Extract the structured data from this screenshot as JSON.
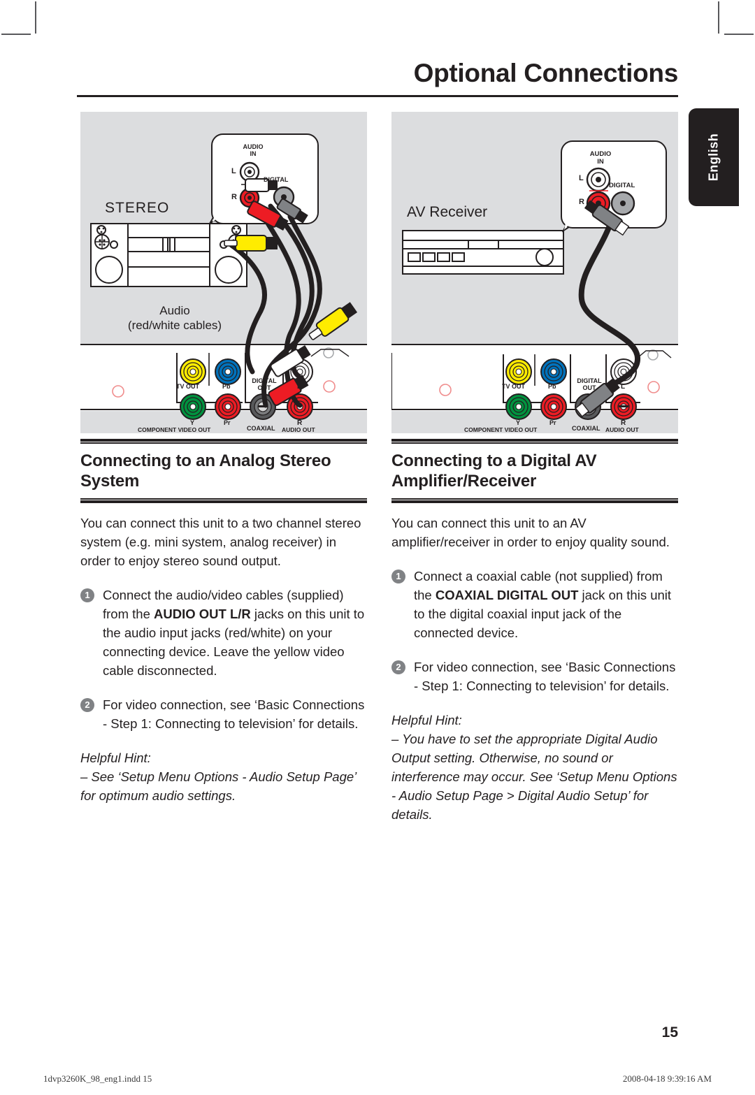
{
  "page": {
    "title": "Optional Connections",
    "language_tab": "English",
    "folio": "15",
    "footer_file": "1dvp3260K_98_eng1.indd   15",
    "footer_stamp": "2008-04-18   9:39:16 AM"
  },
  "colors": {
    "ink": "#231f20",
    "panel_grey": "#dcdddf",
    "bullet_grey": "#808285",
    "jack_yellow": "#ffec00",
    "jack_blue": "#0072bc",
    "jack_green": "#00923f",
    "jack_red": "#ed1c24",
    "jack_white": "#ffffff",
    "jack_black": "#58595b"
  },
  "figures": {
    "left": {
      "device_label": "STEREO",
      "cable_label_line1": "Audio",
      "cable_label_line2": "(red/white cables)",
      "callout": {
        "title_line1": "AUDIO",
        "title_line2": "IN",
        "jack_l": "L",
        "jack_r": "R",
        "jack_digital": "DIGITAL"
      },
      "panel": {
        "tv_out": "TV OUT",
        "pb": "Pb",
        "y": "Y",
        "pr": "Pr",
        "component_video_out": "COMPONENT VIDEO OUT",
        "digital_out_line1": "DIGITAL",
        "digital_out_line2": "OUT",
        "coaxial": "COAXIAL",
        "audio_l": "L",
        "audio_r": "R",
        "audio_out": "AUDIO OUT"
      }
    },
    "right": {
      "device_label": "AV Receiver",
      "callout": {
        "title_line1": "AUDIO",
        "title_line2": "IN",
        "jack_l": "L",
        "jack_r": "R",
        "jack_digital": "DIGITAL"
      },
      "panel": {
        "tv_out": "TV OUT",
        "pb": "Pb",
        "y": "Y",
        "pr": "Pr",
        "component_video_out": "COMPONENT VIDEO OUT",
        "digital_out_line1": "DIGITAL",
        "digital_out_line2": "OUT",
        "coaxial": "COAXIAL",
        "audio_l": "L",
        "audio_r": "R",
        "audio_out": "AUDIO OUT"
      }
    }
  },
  "sections": {
    "left": {
      "heading": "Connecting to an Analog Stereo System",
      "intro": "You can connect this unit to a two channel stereo system (e.g. mini system, analog receiver) in order to enjoy stereo sound output.",
      "step1_num": "1",
      "step1_a": "Connect the audio/video cables (supplied) from the ",
      "step1_bold": "AUDIO OUT L/R",
      "step1_b": " jacks on this unit to the audio input jacks (red/white) on your connecting device. Leave the yellow video cable disconnected.",
      "step2_num": "2",
      "step2": "For video connection, see ‘Basic Connections - Step 1: Connecting to television’ for details.",
      "hint_title": "Helpful Hint:",
      "hint_body": "–  See ‘Setup Menu Options - Audio Setup Page’ for optimum audio settings."
    },
    "right": {
      "heading": "Connecting to a Digital AV Amplifier/Receiver",
      "intro": "You can connect this unit to an AV amplifier/receiver in order to enjoy quality sound.",
      "step1_num": "1",
      "step1_a": "Connect a coaxial cable (not supplied) from the ",
      "step1_bold": "COAXIAL DIGITAL OUT",
      "step1_b": " jack on this unit to the digital coaxial input jack of the connected device.",
      "step2_num": "2",
      "step2": "For video connection, see ‘Basic Connections - Step 1: Connecting to television’ for details.",
      "hint_title": "Helpful Hint:",
      "hint_body": "–  You have to set the appropriate Digital Audio Output setting. Otherwise, no sound or interference may occur. See ‘Setup Menu Options - Audio Setup Page  >  Digital Audio Setup’ for details."
    }
  }
}
